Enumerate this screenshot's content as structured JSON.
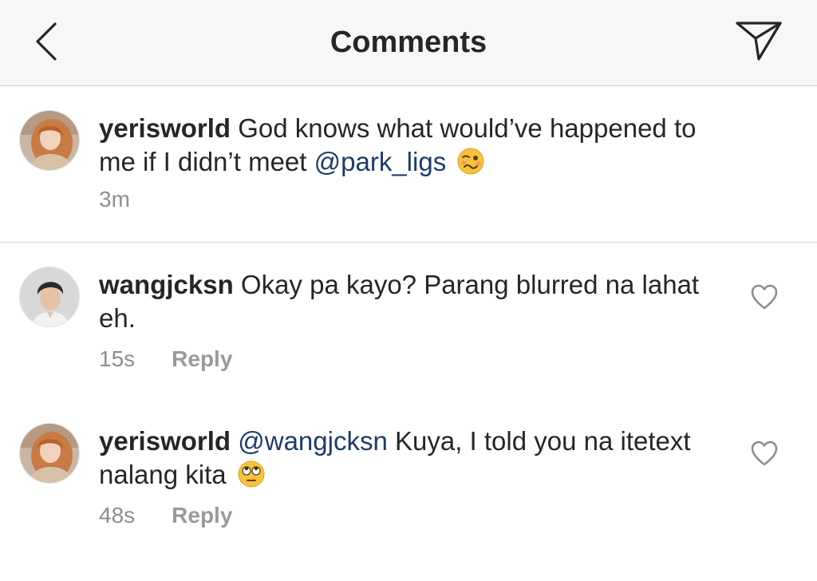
{
  "header": {
    "title": "Comments",
    "back_icon": "chevron-left-icon",
    "send_icon": "paper-plane-icon"
  },
  "caption": {
    "username": "yerisworld",
    "text_before": "God knows what would’ve happened to me if I didn’t meet",
    "mention": "@park_ligs",
    "emoji": "woozy-face-emoji",
    "time": "3m"
  },
  "comments": [
    {
      "username": "wangjcksn",
      "text": "Okay pa kayo? Parang blurred na lahat eh.",
      "time": "15s",
      "reply_label": "Reply",
      "like_icon": "heart-outline-icon"
    },
    {
      "username": "yerisworld",
      "mention": "@wangjcksn",
      "text": "Kuya, I told you na itetext nalang kita",
      "emoji": "face-with-rolling-eyes-emoji",
      "time": "48s",
      "reply_label": "Reply",
      "like_icon": "heart-outline-icon"
    }
  ],
  "colors": {
    "header_bg": "#f7f7f8",
    "text": "#262626",
    "muted": "#8e8e8e",
    "mention": "#1f3b6b"
  }
}
